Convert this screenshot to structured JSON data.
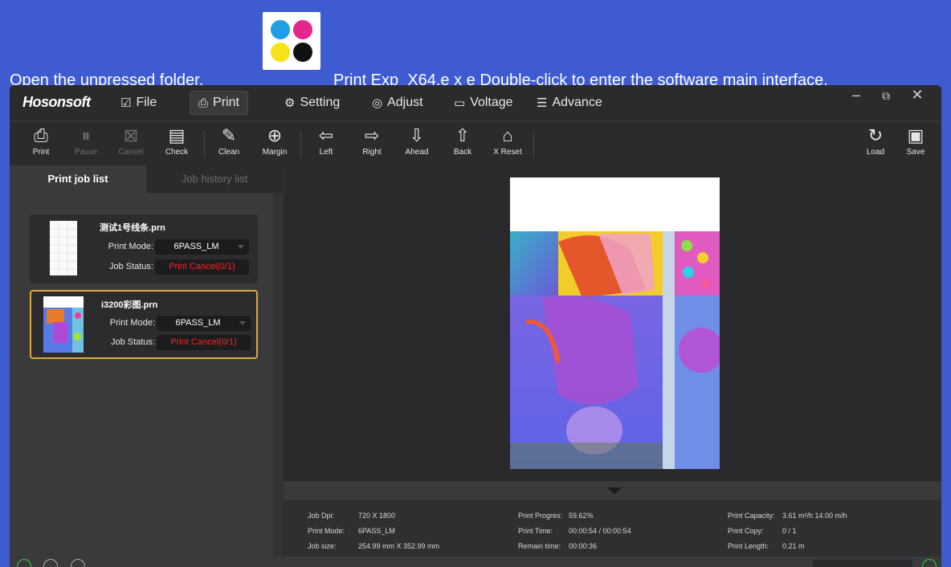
{
  "banner": {
    "before": "Open the unpressed folder,",
    "after": "Print Exp_X64.e x e Double-click to enter the software main interface,"
  },
  "colors": {
    "banner": "#3f5bd1",
    "accent_selected": "#e0a83a",
    "status_red": "#ff2020",
    "status_green": "#2fd12f"
  },
  "app": {
    "brand": "Hosonsoft",
    "menu": [
      {
        "label": "File",
        "icon": "clipboard-check-icon"
      },
      {
        "label": "Print",
        "icon": "printer-icon",
        "active": true
      },
      {
        "label": "Setting",
        "icon": "gear-icon"
      },
      {
        "label": "Adjust",
        "icon": "target-icon"
      },
      {
        "label": "Voltage",
        "icon": "battery-icon"
      },
      {
        "label": "Advance",
        "icon": "list-icon"
      }
    ],
    "toolbar": {
      "print": "Print",
      "pause": "Pause",
      "cancel": "Cancel",
      "check": "Check",
      "clean": "Clean",
      "margin": "Margin",
      "left": "Left",
      "right": "Right",
      "ahead": "Ahead",
      "back": "Back",
      "xreset": "X Reset",
      "load": "Load",
      "save": "Save"
    },
    "tabs": {
      "jobs": "Print job list",
      "history": "Job history list"
    },
    "jobs": [
      {
        "name": "测试1号线条.prn",
        "mode_label": "Print Mode:",
        "mode": "6PASS_LM",
        "status_label": "Job Status:",
        "status": "Print Cancel(0/1)"
      },
      {
        "name": "i3200彩图.prn",
        "mode_label": "Print Mode:",
        "mode": "6PASS_LM",
        "status_label": "Job Status:",
        "status": "Print Cancel(0/1)"
      }
    ],
    "info": {
      "dpi_k": "Job Dpi:",
      "dpi_v": "720 X 1800",
      "mode_k": "Print Mode:",
      "mode_v": "6PASS_LM",
      "size_k": "Job size:",
      "size_v": "254.99 mm  X  352.99 mm",
      "prog_k": "Print Progres:",
      "prog_v": "59.62%",
      "time_k": "Print Time:",
      "time_v": "00:00:54 / 00:00:54",
      "remain_k": "Remain time:",
      "remain_v": "00:00:36",
      "cap_k": "Print Capacity:",
      "cap_v": "3.61 m²/h   14.00 m/h",
      "copy_k": "Print Copy:",
      "copy_v": "0 / 1",
      "len_k": "Print Length:",
      "len_v": "0.21 m"
    }
  }
}
